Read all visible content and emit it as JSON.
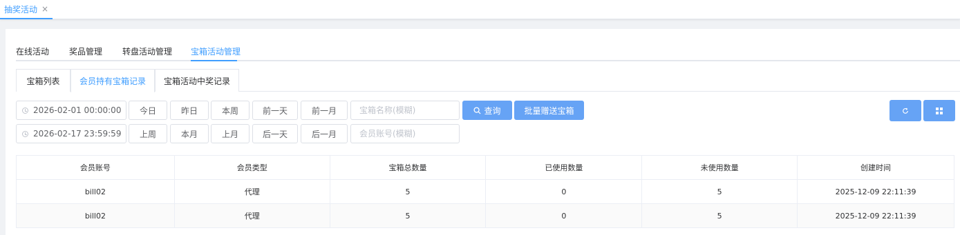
{
  "top_tab": {
    "label": "抽奖活动",
    "close": "×"
  },
  "tabs_primary": [
    {
      "label": "在线活动"
    },
    {
      "label": "奖品管理"
    },
    {
      "label": "转盘活动管理"
    },
    {
      "label": "宝箱活动管理"
    }
  ],
  "tabs_secondary": [
    {
      "label": "宝箱列表"
    },
    {
      "label": "会员持有宝箱记录"
    },
    {
      "label": "宝箱活动中奖记录"
    }
  ],
  "filters": {
    "start_date": "2026-02-01 00:00:00",
    "end_date": "2026-02-17 23:59:59",
    "row1_buttons": [
      "今日",
      "昨日",
      "本周",
      "前一天",
      "前一月"
    ],
    "row2_buttons": [
      "上周",
      "本月",
      "上月",
      "后一天",
      "后一月"
    ],
    "chest_name_placeholder": "宝箱名称(模糊)",
    "member_account_placeholder": "会员账号(模糊)",
    "search_label": "查询",
    "bulk_gift_label": "批量赠送宝箱"
  },
  "table": {
    "headers": [
      "会员账号",
      "会员类型",
      "宝箱总数量",
      "已使用数量",
      "未使用数量",
      "创建时间"
    ],
    "rows": [
      [
        "bill02",
        "代理",
        "5",
        "0",
        "5",
        "2025-12-09 22:11:39"
      ],
      [
        "bill02",
        "代理",
        "5",
        "0",
        "5",
        "2025-12-09 22:11:39"
      ]
    ]
  },
  "colors": {
    "accent": "#409eff",
    "button_primary": "#66a3f5"
  },
  "icons": {
    "search": "search-icon",
    "refresh": "refresh-icon",
    "grid": "grid-icon",
    "clock": "clock-icon"
  }
}
